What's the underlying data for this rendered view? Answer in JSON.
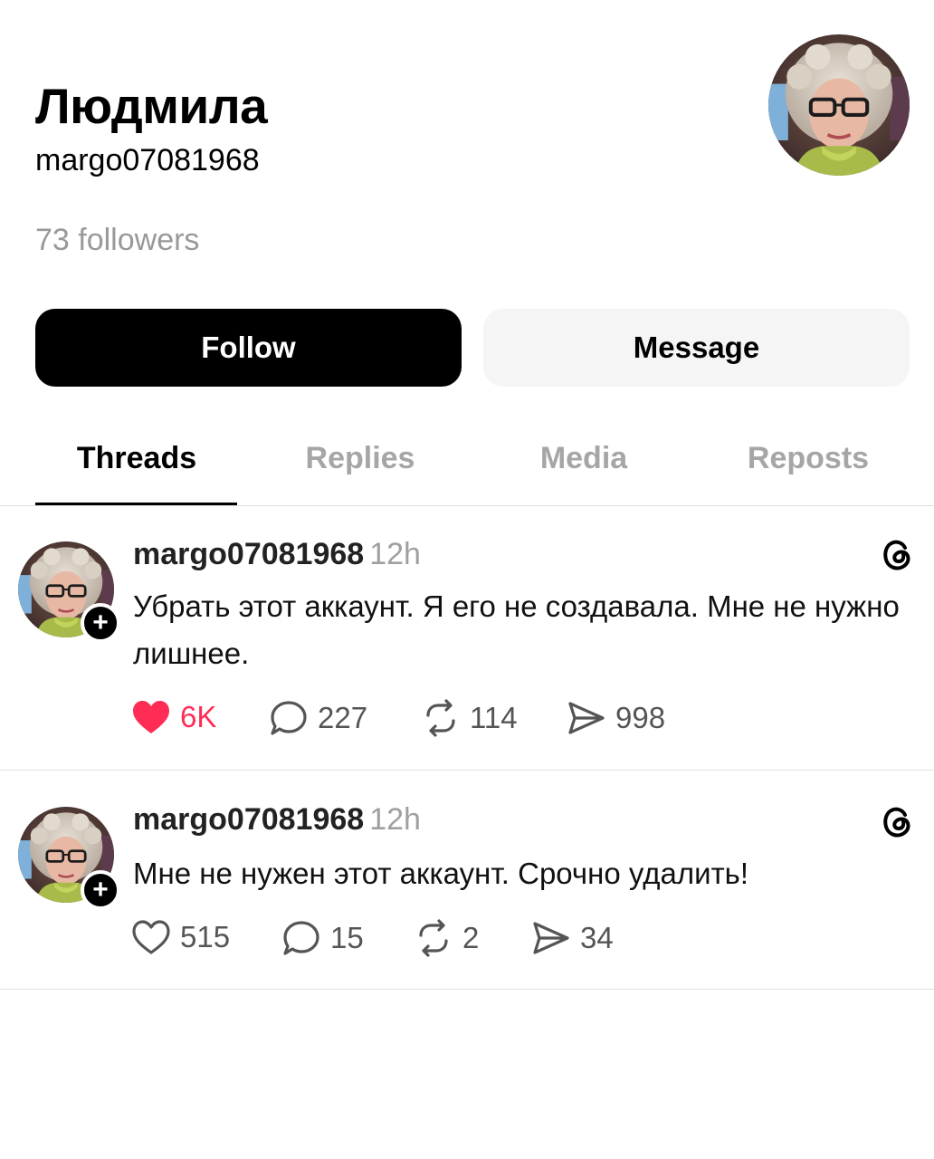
{
  "profile": {
    "display_name": "Людмила",
    "username": "margo07081968",
    "followers": "73 followers",
    "avatar_icon": "user-avatar-photo"
  },
  "buttons": {
    "follow_label": "Follow",
    "message_label": "Message"
  },
  "tabs": [
    {
      "label": "Threads",
      "active": true
    },
    {
      "label": "Replies",
      "active": false
    },
    {
      "label": "Media",
      "active": false
    },
    {
      "label": "Reposts",
      "active": false
    }
  ],
  "posts": [
    {
      "username": "margo07081968",
      "time": "12h",
      "text": "Убрать этот аккаунт. Я его не создавала. Мне не нужно лишнее.",
      "likes": "6K",
      "liked": true,
      "replies": "227",
      "reposts": "114",
      "shares": "998"
    },
    {
      "username": "margo07081968",
      "time": "12h",
      "text": "Мне не нужен этот аккаунт. Срочно удалить!",
      "likes": "515",
      "liked": false,
      "replies": "15",
      "reposts": "2",
      "shares": "34"
    }
  ],
  "colors": {
    "like_active": "#ff2d55",
    "muted_text": "#999999",
    "primary_button": "#000000",
    "secondary_button": "#f5f5f5"
  }
}
